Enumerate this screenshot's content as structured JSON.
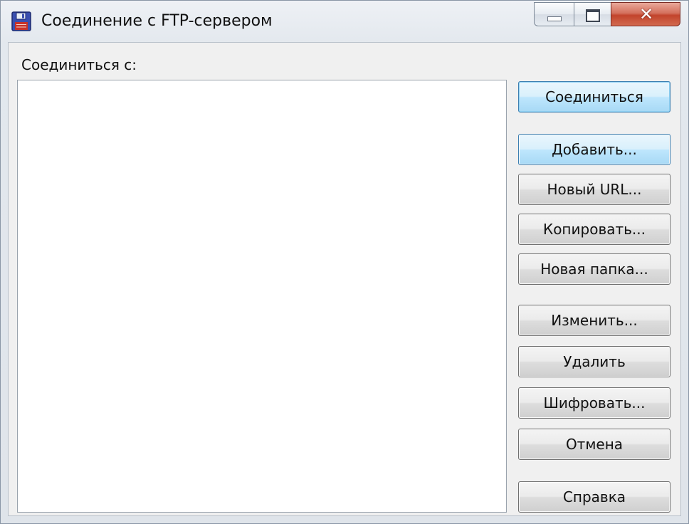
{
  "window": {
    "title": "Соединение с FTP-сервером",
    "icon": "floppy-disk-icon",
    "caption": {
      "minimize": "minimize-icon",
      "maximize": "maximize-icon",
      "close": "✕"
    }
  },
  "connect_to_label": "Соединиться с:",
  "server_list": [],
  "buttons": {
    "connect": "Соединиться",
    "add": "Добавить...",
    "new_url": "Новый URL...",
    "copy": "Копировать...",
    "new_folder": "Новая папка...",
    "edit": "Изменить...",
    "delete": "Удалить",
    "encrypt": "Шифровать...",
    "cancel": "Отмена",
    "help": "Справка"
  },
  "colors": {
    "close_button": "#c2442c",
    "default_button_border": "#3c7fb1",
    "icon_body": "#3a4fb0",
    "icon_label": "#c8322a"
  }
}
